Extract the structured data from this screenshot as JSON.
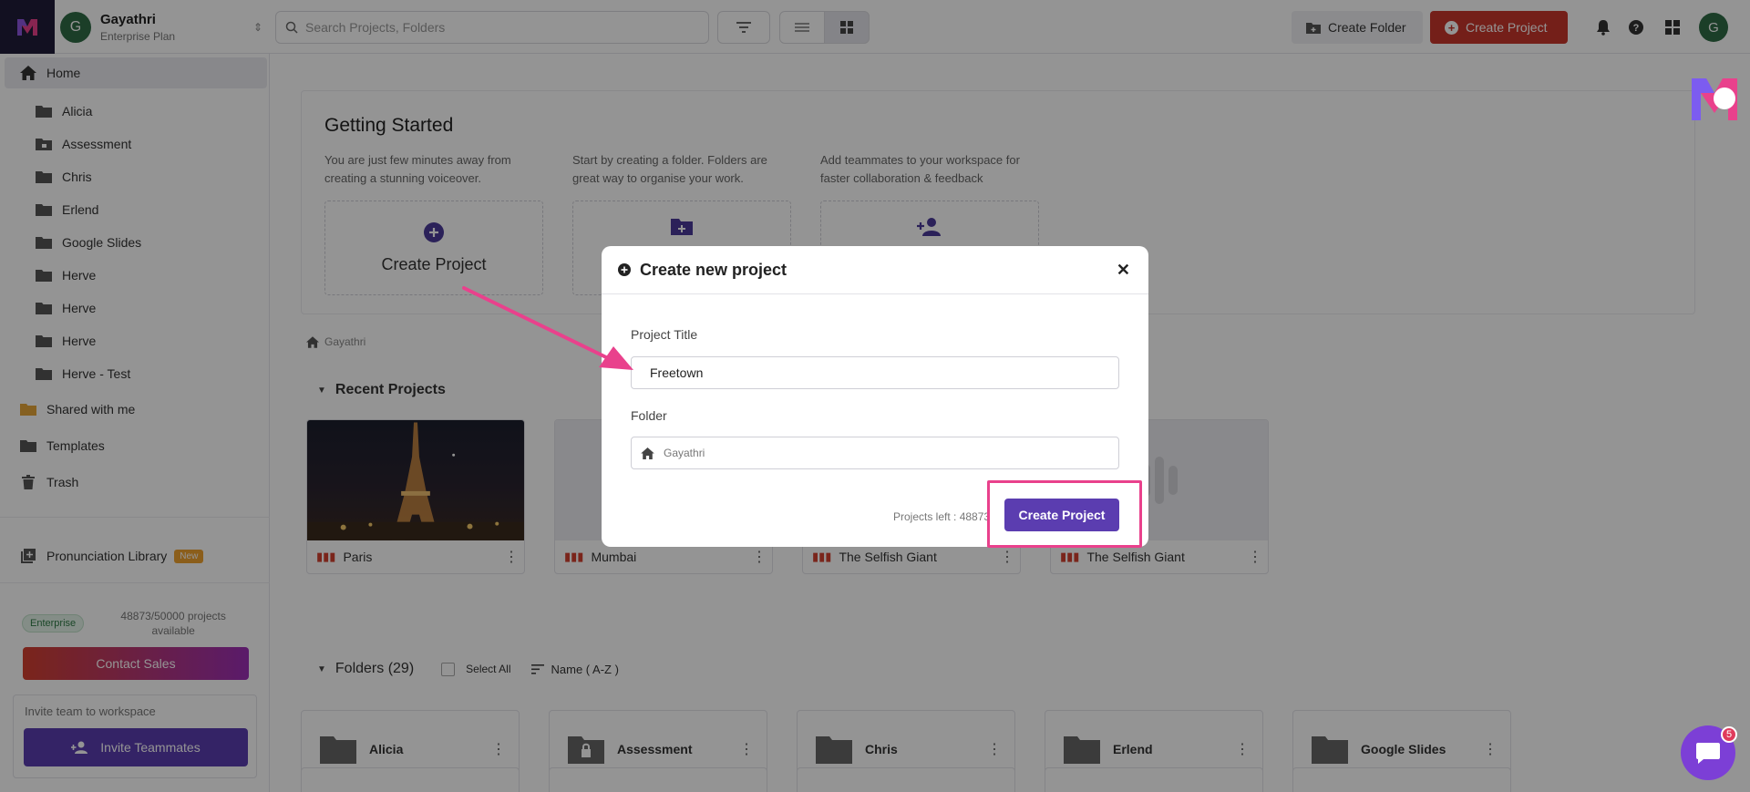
{
  "workspace": {
    "avatar": "G",
    "name": "Gayathri",
    "plan": "Enterprise Plan"
  },
  "topbar": {
    "search_placeholder": "Search Projects, Folders",
    "create_folder": "Create Folder",
    "create_project": "Create Project",
    "user_avatar": "G"
  },
  "sidebar": {
    "home": "Home",
    "folders": [
      "Alicia",
      "Assessment",
      "Chris",
      "Erlend",
      "Google Slides",
      "Herve",
      "Herve",
      "Herve",
      "Herve - Test"
    ],
    "shared": "Shared with me",
    "templates": "Templates",
    "trash": "Trash",
    "pronunciation": "Pronunciation Library",
    "new_badge": "New",
    "enterprise_badge": "Enterprise",
    "projects_count": "48873/50000 projects available",
    "contact_sales": "Contact Sales",
    "invite_label": "Invite team to workspace",
    "invite_button": "Invite Teammates"
  },
  "getting_started": {
    "title": "Getting Started",
    "col1_desc": "You are just few minutes away from creating a stunning voiceover.",
    "col1_label": "Create Project",
    "col2_desc": "Start by creating a folder. Folders are great way to organise your work.",
    "col3_desc": "Add teammates to your workspace for faster collaboration & feedback"
  },
  "breadcrumb": "Gayathri",
  "recent": {
    "title": "Recent Projects",
    "projects": [
      "Paris",
      "Mumbai",
      "The Selfish Giant",
      "The Selfish Giant"
    ]
  },
  "folders": {
    "title": "Folders (29)",
    "select_all": "Select All",
    "sort": "Name ( A-Z )",
    "items": [
      "Alicia",
      "Assessment",
      "Chris",
      "Erlend",
      "Google Slides"
    ]
  },
  "modal": {
    "title": "Create new project",
    "project_title_label": "Project Title",
    "project_title_value": "Freetown",
    "folder_label": "Folder",
    "folder_value": "Gayathri",
    "projects_left": "Projects left : 48873",
    "create_button": "Create Project"
  },
  "chat": {
    "badge": "5"
  },
  "colors": {
    "accent": "#5b3db0",
    "danger": "#c8362c",
    "highlight": "#e9418c"
  }
}
